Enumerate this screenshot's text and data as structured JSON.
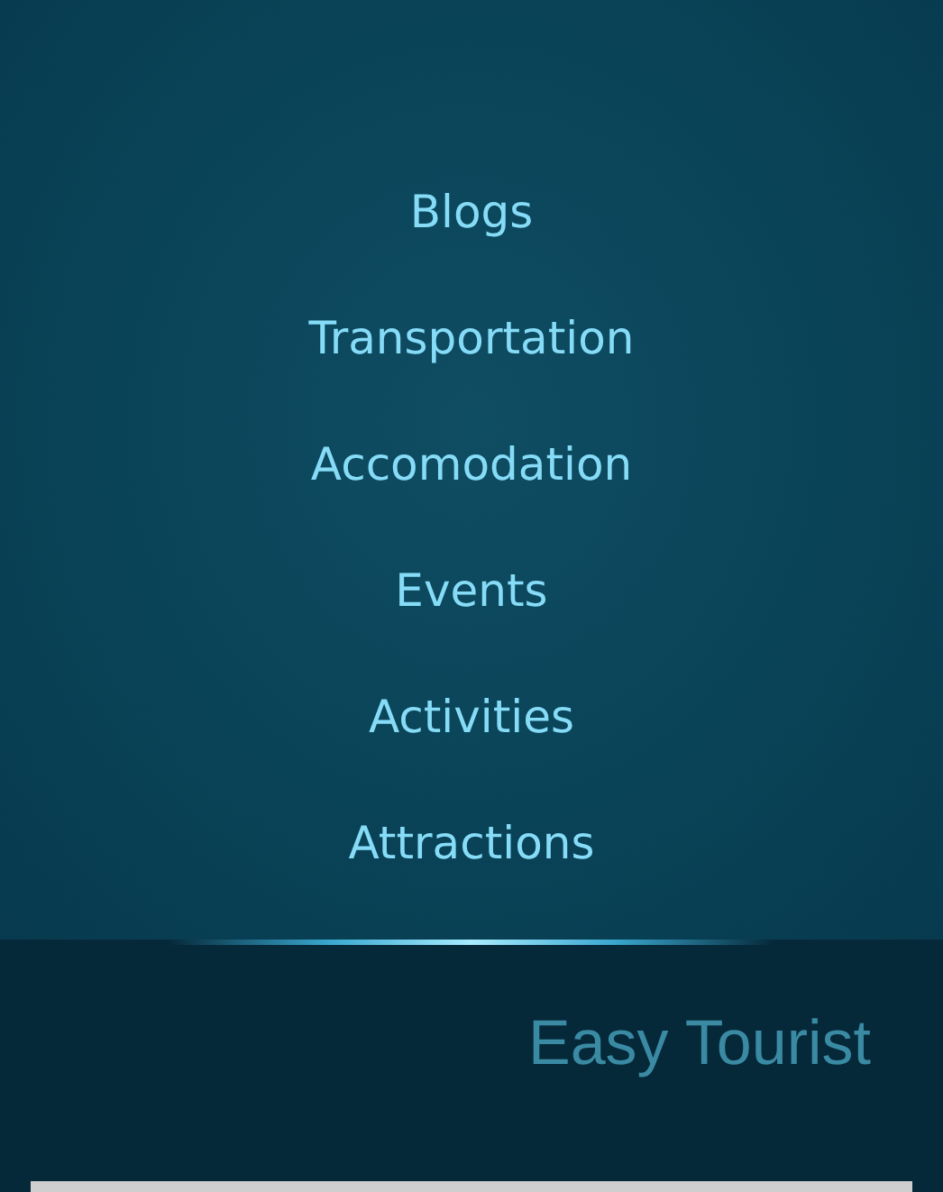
{
  "menu": {
    "items": [
      {
        "label": "Blogs"
      },
      {
        "label": "Transportation"
      },
      {
        "label": "Accomodation"
      },
      {
        "label": "Events"
      },
      {
        "label": "Activities"
      },
      {
        "label": "Attractions"
      }
    ]
  },
  "footer": {
    "brand": "Easy Tourist"
  }
}
